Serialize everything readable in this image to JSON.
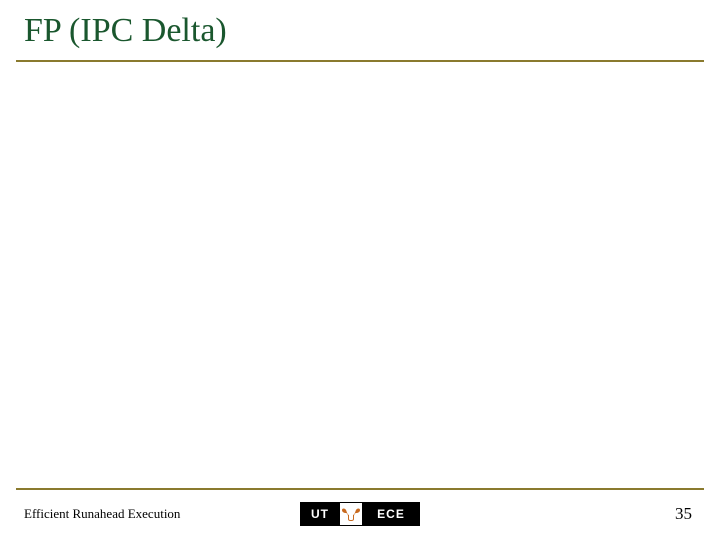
{
  "title": "FP (IPC Delta)",
  "footer": {
    "left": "Efficient Runahead Execution",
    "page_number": "35",
    "logo": {
      "left_text": "UT",
      "right_text": "ECE"
    }
  }
}
